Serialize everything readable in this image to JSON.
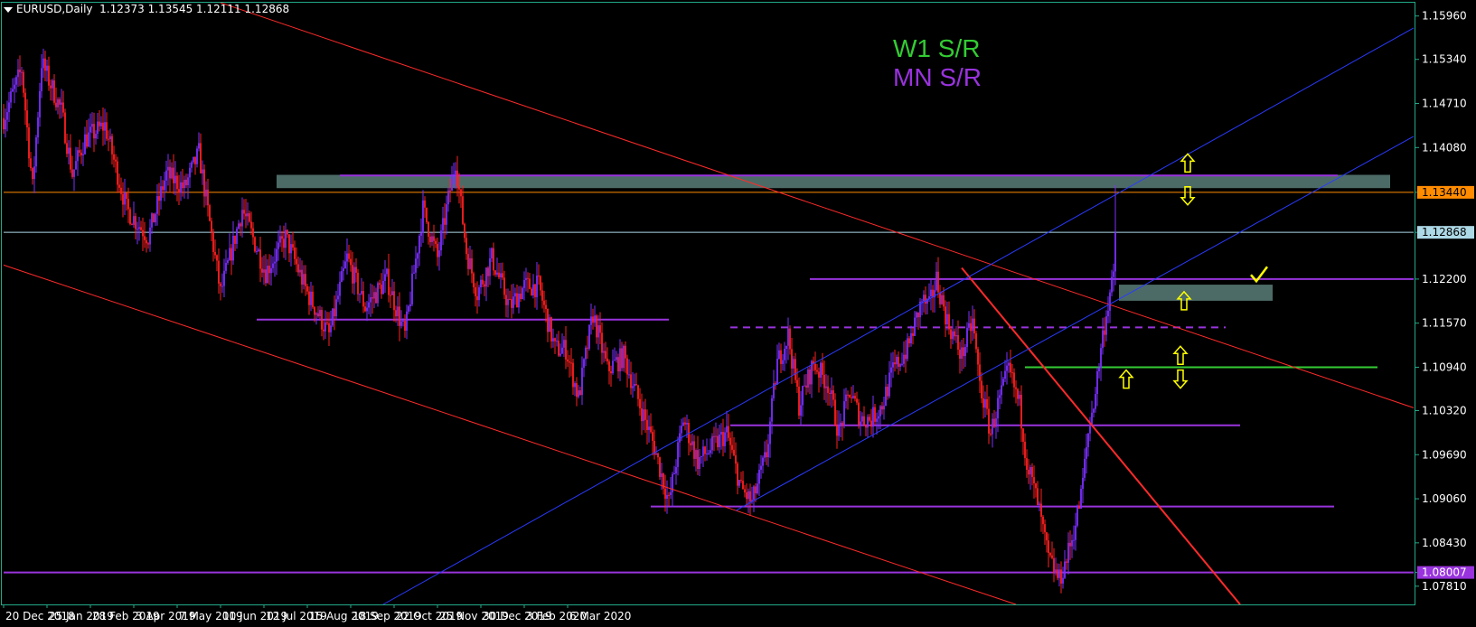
{
  "header": {
    "symbol_line": "EURUSD,Daily",
    "ohlc": "1.12373 1.13545 1.12111 1.12868"
  },
  "legend": [
    {
      "label": "W1 S/R",
      "color": "#33cc33"
    },
    {
      "label": "MN S/R",
      "color": "#9933dd"
    }
  ],
  "chart_data": {
    "type": "candlestick",
    "symbol": "EURUSD",
    "timeframe": "Daily",
    "ylim": [
      1.0755,
      1.1615
    ],
    "y_ticks": [
      "1.15960",
      "1.15340",
      "1.14710",
      "1.14080",
      "1.13440",
      "1.12868",
      "1.12200",
      "1.11570",
      "1.10940",
      "1.10320",
      "1.09690",
      "1.09060",
      "1.08430",
      "1.08007",
      "1.07810"
    ],
    "x_ticks": [
      "20 Dec 2018",
      "25 Jan 2019",
      "28 Feb 2019",
      "3 Apr 2019",
      "7 May 2019",
      "10 Jun 2019",
      "12 Jul 2019",
      "15 Aug 2019",
      "18 Sep 2019",
      "22 Oct 2019",
      "25 Nov 2019",
      "30 Dec 2019",
      "3 Feb 2020",
      "6 Mar 2020"
    ],
    "price_labels": [
      {
        "value": "1.13440",
        "bg": "#ff8c00",
        "fg": "#000000"
      },
      {
        "value": "1.12868",
        "bg": "#add8e6",
        "fg": "#000000"
      },
      {
        "value": "1.08007",
        "bg": "#9933dd",
        "fg": "#ffffff"
      }
    ],
    "price_path": [
      [
        0,
        1.145
      ],
      [
        10,
        1.152
      ],
      [
        16,
        1.135
      ],
      [
        21,
        1.153
      ],
      [
        32,
        1.146
      ],
      [
        38,
        1.137
      ],
      [
        45,
        1.142
      ],
      [
        56,
        1.144
      ],
      [
        68,
        1.132
      ],
      [
        80,
        1.128
      ],
      [
        90,
        1.137
      ],
      [
        100,
        1.135
      ],
      [
        108,
        1.14
      ],
      [
        120,
        1.12
      ],
      [
        132,
        1.132
      ],
      [
        145,
        1.123
      ],
      [
        156,
        1.128
      ],
      [
        168,
        1.12
      ],
      [
        180,
        1.114
      ],
      [
        190,
        1.125
      ],
      [
        200,
        1.118
      ],
      [
        212,
        1.122
      ],
      [
        222,
        1.114
      ],
      [
        232,
        1.132
      ],
      [
        240,
        1.125
      ],
      [
        250,
        1.139
      ],
      [
        256,
        1.126
      ],
      [
        262,
        1.12
      ],
      [
        270,
        1.125
      ],
      [
        280,
        1.118
      ],
      [
        288,
        1.121
      ],
      [
        296,
        1.121
      ],
      [
        305,
        1.112
      ],
      [
        311,
        1.112
      ],
      [
        318,
        1.105
      ],
      [
        326,
        1.117
      ],
      [
        334,
        1.109
      ],
      [
        343,
        1.111
      ],
      [
        352,
        1.104
      ],
      [
        360,
        1.098
      ],
      [
        368,
        1.09
      ],
      [
        376,
        1.102
      ],
      [
        384,
        1.096
      ],
      [
        392,
        1.098
      ],
      [
        400,
        1.1
      ],
      [
        408,
        1.092
      ],
      [
        414,
        1.09
      ],
      [
        422,
        1.097
      ],
      [
        428,
        1.11
      ],
      [
        434,
        1.114
      ],
      [
        440,
        1.104
      ],
      [
        448,
        1.11
      ],
      [
        456,
        1.107
      ],
      [
        462,
        1.1
      ],
      [
        468,
        1.106
      ],
      [
        474,
        1.102
      ],
      [
        480,
        1.102
      ],
      [
        486,
        1.104
      ],
      [
        492,
        1.109
      ],
      [
        500,
        1.112
      ],
      [
        508,
        1.119
      ],
      [
        512,
        1.118
      ],
      [
        516,
        1.122
      ],
      [
        522,
        1.116
      ],
      [
        530,
        1.111
      ],
      [
        536,
        1.116
      ],
      [
        540,
        1.107
      ],
      [
        546,
        1.1
      ],
      [
        550,
        1.104
      ],
      [
        556,
        1.109
      ],
      [
        562,
        1.104
      ],
      [
        566,
        1.096
      ],
      [
        572,
        1.09
      ],
      [
        578,
        1.082
      ],
      [
        584,
        1.079
      ],
      [
        588,
        1.082
      ],
      [
        592,
        1.086
      ],
      [
        596,
        1.091
      ],
      [
        600,
        1.1
      ],
      [
        604,
        1.106
      ],
      [
        608,
        1.114
      ],
      [
        612,
        1.12
      ],
      [
        615,
        1.123
      ]
    ],
    "trendlines": [
      {
        "name": "upper-red",
        "color": "#ff2a2a",
        "points": [
          [
            120,
            1.1615
          ],
          [
            780,
            1.1036
          ]
        ]
      },
      {
        "name": "lower-red",
        "color": "#ff2a2a",
        "points": [
          [
            0,
            1.124
          ],
          [
            560,
            1.0755
          ]
        ]
      },
      {
        "name": "steep-red",
        "color": "#ff2a2a",
        "width": 2,
        "points": [
          [
            530,
            1.1236
          ],
          [
            684,
            1.0755
          ]
        ]
      },
      {
        "name": "blue-upper",
        "color": "#2a3aff",
        "points": [
          [
            210,
            1.0755
          ],
          [
            780,
            1.1579
          ]
        ]
      },
      {
        "name": "blue-lower",
        "color": "#2a3aff",
        "points": [
          [
            405,
            1.0889
          ],
          [
            780,
            1.1424
          ]
        ]
      }
    ],
    "sr_levels": [
      {
        "name": "mn-upper-level",
        "value": 1.1368,
        "color": "#9933dd",
        "x_from": 186,
        "x_to": 738
      },
      {
        "name": "orange-level",
        "value": 1.1344,
        "color": "#ff8c00",
        "x_from": 0,
        "x_to": 780,
        "width": 1
      },
      {
        "name": "current-price-level",
        "value": 1.12868,
        "color": "#add8e6",
        "x_from": 0,
        "x_to": 780,
        "width": 1
      },
      {
        "name": "mn-level-1-1220",
        "value": 1.122,
        "color": "#9933dd",
        "x_from": 446,
        "x_to": 780
      },
      {
        "name": "mn-level-1-1162",
        "value": 1.1162,
        "color": "#9933dd",
        "x_from": 140,
        "x_to": 368
      },
      {
        "name": "mn-dashed-level",
        "value": 1.1151,
        "color": "#9933dd",
        "x_from": 402,
        "x_to": 676,
        "dash": "8,6"
      },
      {
        "name": "w1-level",
        "value": 1.1094,
        "color": "#33cc33",
        "x_from": 565,
        "x_to": 760
      },
      {
        "name": "mn-level-1-1011",
        "value": 1.1011,
        "color": "#9933dd",
        "x_from": 402,
        "x_to": 684
      },
      {
        "name": "mn-level-1-0895",
        "value": 1.0895,
        "color": "#9933dd",
        "x_from": 358,
        "x_to": 736
      },
      {
        "name": "mn-level-1-0801",
        "value": 1.08007,
        "color": "#9933dd",
        "x_from": 0,
        "x_to": 780
      }
    ],
    "zones": [
      {
        "name": "resistance-zone",
        "y_top": 1.1369,
        "y_bottom": 1.135,
        "x_from": 151,
        "x_to": 767,
        "color": "#4d6b66"
      },
      {
        "name": "support-zone",
        "y_top": 1.1212,
        "y_bottom": 1.1189,
        "x_from": 617,
        "x_to": 702,
        "color": "#4d6b66"
      }
    ],
    "annotations": [
      {
        "type": "arrow-up",
        "x": 655,
        "y": 1.1386
      },
      {
        "type": "arrow-down",
        "x": 655,
        "y": 1.1339
      },
      {
        "type": "arrow-up",
        "x": 653,
        "y": 1.1189
      },
      {
        "type": "arrow-up",
        "x": 651,
        "y": 1.1111
      },
      {
        "type": "arrow-down",
        "x": 651,
        "y": 1.1077
      },
      {
        "type": "arrow-up",
        "x": 621,
        "y": 1.1077
      },
      {
        "type": "check",
        "x": 694,
        "y": 1.1226
      }
    ]
  }
}
